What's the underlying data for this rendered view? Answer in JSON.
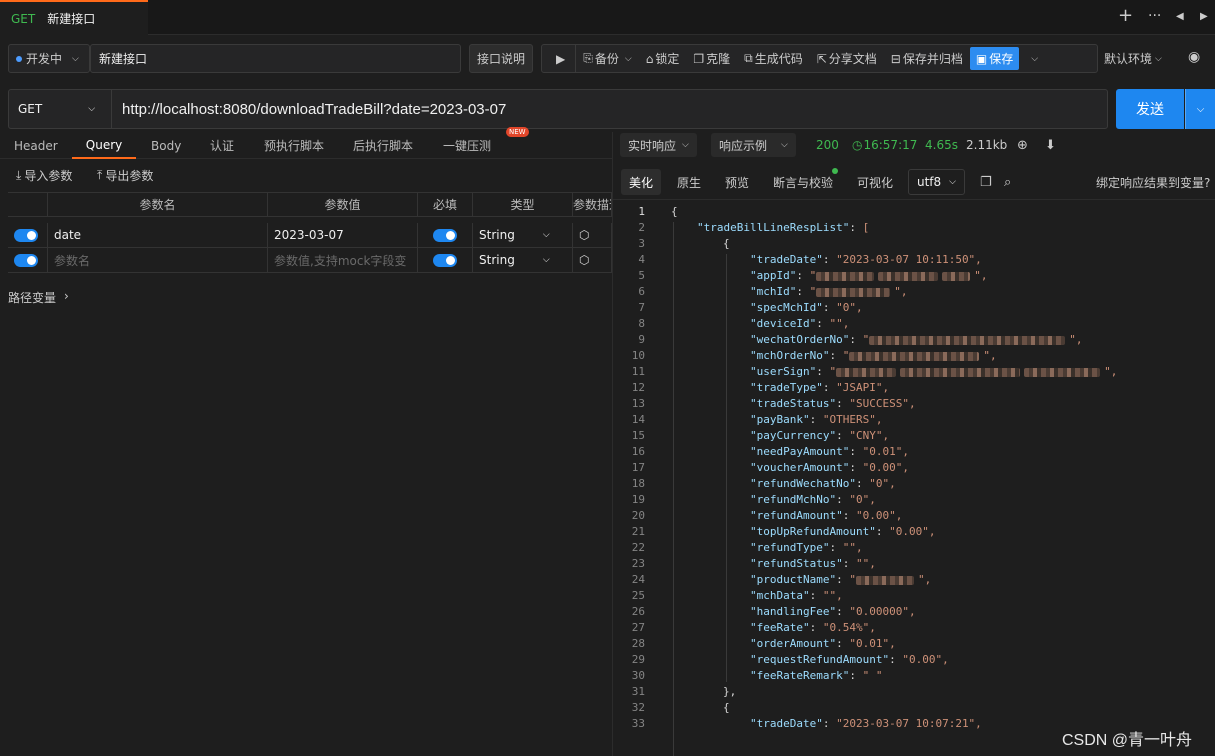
{
  "tab": {
    "method": "GET",
    "title": "新建接口"
  },
  "tabbar_icons": [
    "plus-icon",
    "more-icon",
    "prev-icon",
    "next-icon"
  ],
  "env": {
    "label": "开发中"
  },
  "name_input": {
    "value": "新建接口"
  },
  "desc_button": "接口说明",
  "toolbar": {
    "backup": "备份",
    "lock": "锁定",
    "clone": "克隆",
    "gen_code": "生成代码",
    "share": "分享文档",
    "save_archive": "保存并归档",
    "save": "保存"
  },
  "default_env": "默认环境",
  "request": {
    "method": "GET",
    "url": "http://localhost:8080/downloadTradeBill?date=2023-03-07",
    "send": "发送"
  },
  "req_tabs": [
    "Header",
    "Query",
    "Body",
    "认证",
    "预执行脚本",
    "后执行脚本",
    "一键压测"
  ],
  "new_badge": "NEW",
  "import_params": "导入参数",
  "export_params": "导出参数",
  "table": {
    "headers": [
      "参数名",
      "参数值",
      "必填",
      "类型",
      "参数描述"
    ],
    "rows": [
      {
        "name": "date",
        "value": "2023-03-07",
        "type": "String",
        "enabled": true,
        "required": true
      },
      {
        "name": "",
        "value": "",
        "type": "String",
        "enabled": true,
        "required": true,
        "name_placeholder": "参数名",
        "value_placeholder": "参数值,支持mock字段变"
      }
    ]
  },
  "path_vars": "路径变量",
  "response": {
    "mode": "实时响应",
    "example": "响应示例",
    "status": "200",
    "time": "16:57:17",
    "duration": "4.65s",
    "size": "2.11kb",
    "tabs": [
      "美化",
      "原生",
      "预览",
      "断言与校验",
      "可视化"
    ],
    "encoding": "utf8",
    "bind_label": "绑定响应结果到变量?"
  },
  "code_lines": [
    "{",
    "\"tradeBillLineRespList\": [",
    "{",
    "\"tradeDate\": \"2023-03-07 10:11:50\",",
    "\"appId\": \"",
    "\"mchId\": \"",
    "\"specMchId\": \"0\",",
    "\"deviceId\": \"\",",
    "\"wechatOrderNo\": \"",
    "\"mchOrderNo\": \"",
    "\"userSign\": \"",
    "\"tradeType\": \"JSAPI\",",
    "\"tradeStatus\": \"SUCCESS\",",
    "\"payBank\": \"OTHERS\",",
    "\"payCurrency\": \"CNY\",",
    "\"needPayAmount\": \"0.01\",",
    "\"voucherAmount\": \"0.00\",",
    "\"refundWechatNo\": \"0\",",
    "\"refundMchNo\": \"0\",",
    "\"refundAmount\": \"0.00\",",
    "\"topUpRefundAmount\": \"0.00\",",
    "\"refundType\": \"\",",
    "\"refundStatus\": \"\",",
    "\"productName\": \"",
    "\"mchData\": \"\",",
    "\"handlingFee\": \"0.00000\",",
    "\"feeRate\": \"0.54%\",",
    "\"orderAmount\": \"0.01\",",
    "\"requestRefundAmount\": \"0.00\",",
    "\"feeRateRemark\": \" \"",
    "},",
    "{",
    "\"tradeDate\": \"2023-03-07 10:07:21\","
  ],
  "watermark": "CSDN @青一叶舟",
  "colors": {
    "accent": "#ff6a1a",
    "primary": "#1e87f0",
    "method_green": "#3fb950"
  }
}
